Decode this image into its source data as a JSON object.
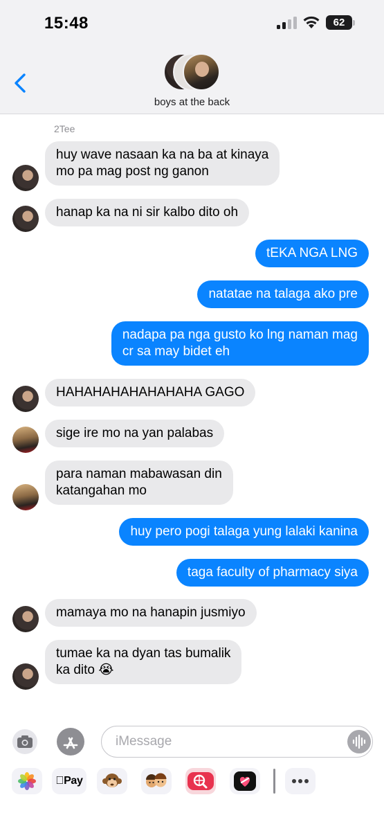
{
  "status_bar": {
    "time": "15:48",
    "battery": "62"
  },
  "header": {
    "group_name": "boys at the back"
  },
  "conversation": {
    "sender_label": "2Tee",
    "messages": [
      {
        "dir": "in",
        "line1": "huy wave nasaan ka na ba at kinaya",
        "line2": "mo pa mag post ng ganon"
      },
      {
        "dir": "in",
        "line1": "hanap ka na ni sir kalbo dito oh"
      },
      {
        "dir": "out",
        "line1": "tEKA NGA LNG"
      },
      {
        "dir": "out",
        "line1": "natatae na talaga ako pre"
      },
      {
        "dir": "out",
        "line1": "nadapa pa nga gusto ko lng naman mag",
        "line2": "cr sa may bidet eh"
      },
      {
        "dir": "in",
        "line1": "HAHAHAHAHAHAHAHA GAGO"
      },
      {
        "dir": "in",
        "line1": "sige ire mo na yan palabas"
      },
      {
        "dir": "in",
        "line1": "para naman mabawasan din",
        "line2": "katangahan mo"
      },
      {
        "dir": "out",
        "line1": "huy pero pogi talaga yung lalaki kanina"
      },
      {
        "dir": "out",
        "line1": "taga faculty of pharmacy siya"
      },
      {
        "dir": "in",
        "line1": "mamaya mo na hanapin jusmiyo"
      },
      {
        "dir": "in",
        "line1": "tumae ka na dyan tas bumalik",
        "line2": "ka dito 😭"
      }
    ]
  },
  "input": {
    "placeholder": "iMessage"
  },
  "app_tray": {
    "apple_pay_label": "Pay"
  },
  "colors": {
    "outgoing_bubble": "#0a84ff",
    "incoming_bubble": "#e9e9eb",
    "header_bg": "#f2f2f4"
  },
  "icons": [
    "back-chevron-icon",
    "camera-icon",
    "app-store-icon",
    "audio-waveform-icon",
    "photos-icon",
    "apple-pay-icon",
    "monkey-memoji-icon",
    "memoji-stickers-icon",
    "image-search-icon",
    "digital-touch-icon",
    "more-icon"
  ]
}
